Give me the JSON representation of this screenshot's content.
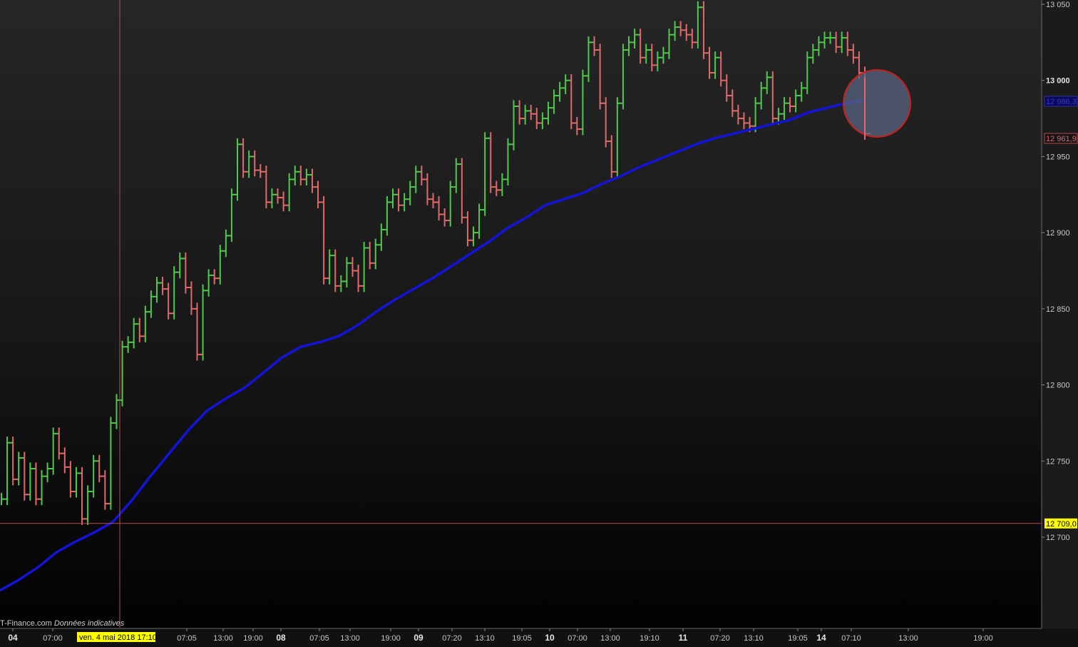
{
  "watermark": {
    "source": "T-Finance.com",
    "note": "Données indicatives"
  },
  "crosshair": {
    "date_label": "ven. 4 mai 2018 17:10",
    "price_label": "12 709,0",
    "price": 12709.0
  },
  "price_tags": {
    "last_price": "12 961,9",
    "ma_value": "12 986,3",
    "last_price_value": 12961.9,
    "ma_value_num": 12986.3
  },
  "colors": {
    "up": "#4ec94e",
    "down": "#e06a6a",
    "ma": "#1414d8",
    "crosshair": "#b84a4a",
    "price_tag_bg": "#ffff00",
    "ma_tag_bg": "#0a0a5a",
    "last_tag_border": "#b84a4a",
    "highlight_fill": "#5a6480",
    "highlight_stroke": "#c82020"
  },
  "chart_data": {
    "type": "line",
    "title": "",
    "ylim": [
      12660,
      13050
    ],
    "y_ticks": [
      {
        "value": 13050,
        "label": "13 050",
        "major": false
      },
      {
        "value": 13000,
        "label": "13 000",
        "major": true
      },
      {
        "value": 12950,
        "label": "12 950",
        "major": false
      },
      {
        "value": 12900,
        "label": "12 900",
        "major": false
      },
      {
        "value": 12850,
        "label": "12 850",
        "major": false
      },
      {
        "value": 12800,
        "label": "12 800",
        "major": false
      },
      {
        "value": 12750,
        "label": "12 750",
        "major": false
      },
      {
        "value": 12700,
        "label": "12 700",
        "major": false
      }
    ],
    "x_ticks": [
      {
        "label": "04",
        "day": true
      },
      {
        "label": "07:00",
        "day": false
      },
      {
        "label": "07:05",
        "day": false
      },
      {
        "label": "13:00",
        "day": false
      },
      {
        "label": "19:00",
        "day": false
      },
      {
        "label": "08",
        "day": true
      },
      {
        "label": "07:05",
        "day": false
      },
      {
        "label": "13:00",
        "day": false
      },
      {
        "label": "19:00",
        "day": false
      },
      {
        "label": "09",
        "day": true
      },
      {
        "label": "07:20",
        "day": false
      },
      {
        "label": "13:10",
        "day": false
      },
      {
        "label": "19:05",
        "day": false
      },
      {
        "label": "10",
        "day": true
      },
      {
        "label": "07:00",
        "day": false
      },
      {
        "label": "13:00",
        "day": false
      },
      {
        "label": "19:10",
        "day": false
      },
      {
        "label": "11",
        "day": true
      },
      {
        "label": "07:20",
        "day": false
      },
      {
        "label": "13:10",
        "day": false
      },
      {
        "label": "19:05",
        "day": false
      },
      {
        "label": "14",
        "day": true
      },
      {
        "label": "07:10",
        "day": false
      },
      {
        "label": "13:00",
        "day": false
      },
      {
        "label": "19:00",
        "day": false
      }
    ],
    "series": [
      {
        "kind": "price",
        "values": [
          12725,
          12762,
          12738,
          12752,
          12728,
          12745,
          12725,
          12740,
          12745,
          12768,
          12755,
          12746,
          12730,
          12742,
          12712,
          12730,
          12750,
          12740,
          12722,
          12775,
          12790,
          12825,
          12828,
          12840,
          12832,
          12848,
          12858,
          12867,
          12863,
          12847,
          12874,
          12883,
          12864,
          12850,
          12820,
          12862,
          12872,
          12870,
          12888,
          12898,
          12925,
          12958,
          12940,
          12950,
          12941,
          12940,
          12920,
          12925,
          12923,
          12918,
          12935,
          12940,
          12935,
          12938,
          12930,
          12920,
          12870,
          12885,
          12865,
          12868,
          12880,
          12875,
          12865,
          12890,
          12880,
          12892,
          12902,
          12920,
          12925,
          12918,
          12922,
          12930,
          12940,
          12935,
          12922,
          12920,
          12912,
          12908,
          12930,
          12945,
          12910,
          12895,
          12900,
          12915,
          12962,
          12930,
          12928,
          12935,
          12958,
          12983,
          12975,
          12980,
          12978,
          12972,
          12975,
          12982,
          12990,
          12995,
          13000,
          12972,
          12968,
          13003,
          13025,
          13020,
          12985,
          12960,
          12940,
          12985,
          13020,
          13025,
          13030,
          13015,
          13020,
          13010,
          13015,
          13018,
          13030,
          13035,
          13033,
          13030,
          13025,
          13048,
          13018,
          13005,
          13015,
          13000,
          12990,
          12980,
          12975,
          12972,
          12970,
          12985,
          12995,
          13002,
          12975,
          12978,
          12985,
          12983,
          12990,
          12995,
          13015,
          13020,
          13025,
          13028,
          13028,
          13022,
          13028,
          13020,
          13015,
          13005,
          12965
        ]
      },
      {
        "kind": "ma",
        "name": "",
        "values": [
          12665,
          12672,
          12680,
          12690,
          12697,
          12703,
          12710,
          12724,
          12740,
          12755,
          12770,
          12783,
          12791,
          12798,
          12808,
          12818,
          12825,
          12828,
          12832,
          12839,
          12848,
          12856,
          12863,
          12870,
          12878,
          12886,
          12894,
          12903,
          12910,
          12918,
          12922,
          12926,
          12932,
          12937,
          12943,
          12948,
          12953,
          12958,
          12962,
          12965,
          12968,
          12971,
          12974,
          12979,
          12982,
          12985,
          12987
        ]
      }
    ],
    "annotations": [
      {
        "type": "circle",
        "x_index": 151,
        "value": 12987
      }
    ]
  }
}
